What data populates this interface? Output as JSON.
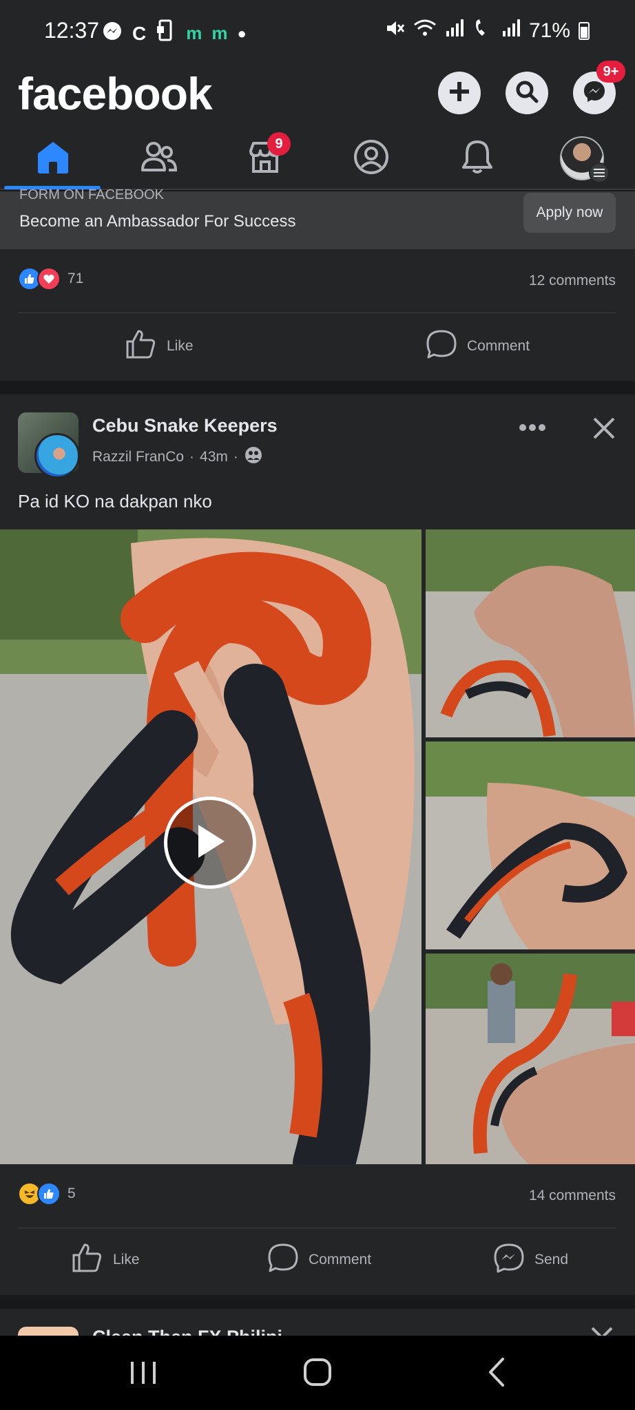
{
  "status_bar": {
    "time": "12:37",
    "notif_glyphs": [
      "m",
      "m"
    ],
    "battery": "71%"
  },
  "header": {
    "logo": "facebook",
    "messenger_badge": "9+"
  },
  "tabs": {
    "marketplace_badge": "9"
  },
  "ad_card": {
    "source_label": "FORM ON FACEBOOK",
    "headline": "Become an Ambassador For Success",
    "apply_label": "Apply now",
    "reaction_count": "71",
    "comments": "12 comments",
    "like_label": "Like",
    "comment_label": "Comment"
  },
  "post": {
    "group_name": "Cebu Snake Keepers",
    "author": "Razzil FranCo",
    "time": "43m",
    "text": "Pa id KO na dakpan nko",
    "reaction_count": "5",
    "comments": "14 comments",
    "like_label": "Like",
    "comment_label": "Comment",
    "send_label": "Send"
  },
  "next_post": {
    "title": "Clean Then FX Philipi..."
  },
  "colors": {
    "accent": "#2d88ff",
    "badge": "#e41e3f",
    "background": "#18191a",
    "card": "#242526"
  }
}
